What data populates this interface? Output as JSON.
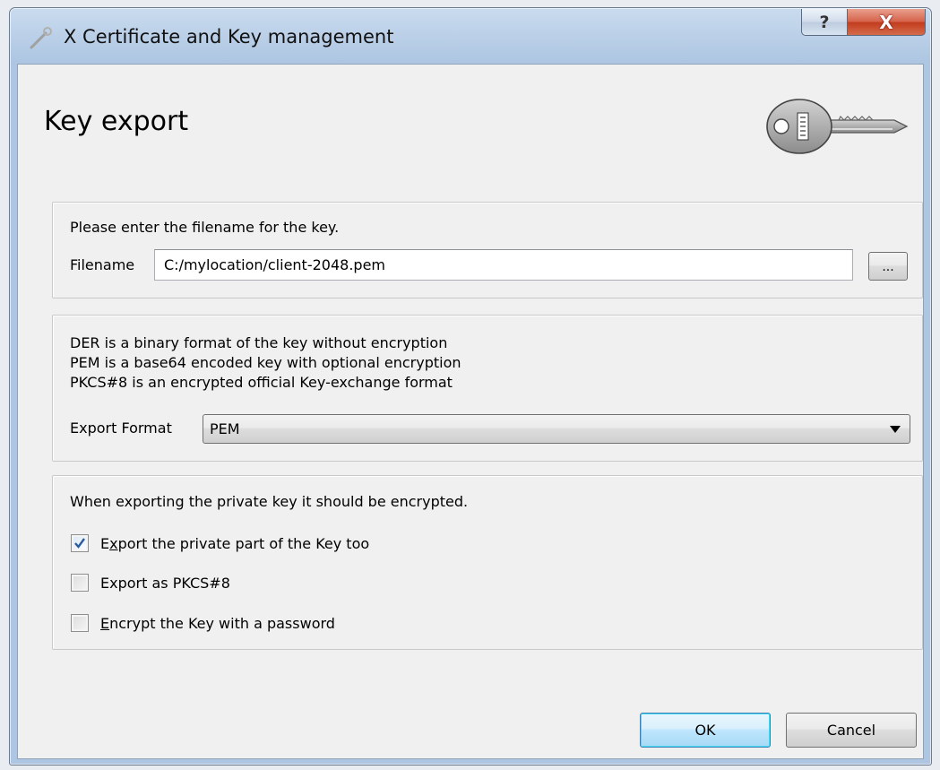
{
  "window": {
    "title": "X Certificate and Key management",
    "help_label": "?",
    "close_label": "X"
  },
  "header": {
    "title": "Key export",
    "logo_icon": "key-icon"
  },
  "filename_group": {
    "prompt": "Please enter the filename for the key.",
    "label": "Filename",
    "value": "C:/mylocation/client-2048.pem",
    "browse_label": "..."
  },
  "format_group": {
    "lines": [
      "DER is a binary format of the key without encryption",
      "PEM is a base64 encoded key with optional encryption",
      "PKCS#8 is an encrypted official Key-exchange format"
    ],
    "label": "Export Format",
    "selected": "PEM"
  },
  "private_group": {
    "note": "When exporting the private key it should be encrypted.",
    "options": [
      {
        "pre": "E",
        "mnemonic": "x",
        "post": "port the private part of the Key too",
        "checked": true
      },
      {
        "pre": "Export as PKCS#8",
        "mnemonic": "",
        "post": "",
        "checked": false
      },
      {
        "pre": "",
        "mnemonic": "E",
        "post": "ncrypt the Key with a password",
        "checked": false
      }
    ]
  },
  "buttons": {
    "ok": "OK",
    "cancel": "Cancel"
  },
  "colors": {
    "accent": "#3c7fb1",
    "check": "#2b5b9a"
  }
}
